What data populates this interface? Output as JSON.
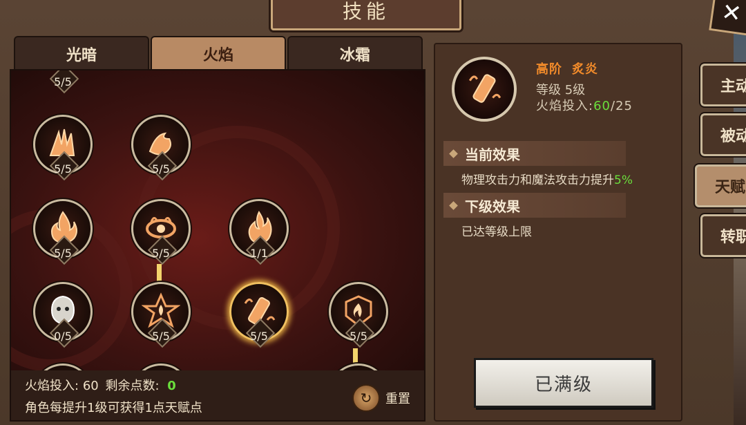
{
  "window": {
    "title": "技能"
  },
  "tabs": [
    {
      "label": "光暗",
      "active": false
    },
    {
      "label": "火焰",
      "active": true
    },
    {
      "label": "冰霜",
      "active": false
    }
  ],
  "tree": {
    "top_partial_level": "5/5",
    "nodes": [
      {
        "name": "fire-claw-skill",
        "level": "5/5"
      },
      {
        "name": "fire-bird-skill",
        "level": "5/5"
      },
      {
        "name": "flame-skill",
        "level": "5/5"
      },
      {
        "name": "fire-eye-skill",
        "level": "5/5"
      },
      {
        "name": "blaze-skill",
        "level": "1/1"
      },
      {
        "name": "shadow-spirit-skill",
        "level": "0/5"
      },
      {
        "name": "fire-pentagram-skill",
        "level": "5/5"
      },
      {
        "name": "burning-skill",
        "level": "5/5",
        "selected": true
      },
      {
        "name": "fire-shield-skill",
        "level": "5/5"
      }
    ]
  },
  "footer": {
    "invest_label": "火焰投入:",
    "invest_value": "60",
    "remaining_label": "剩余点数:",
    "remaining_value": "0",
    "hint": "角色每提升1级可获得1点天赋点",
    "reset_label": "重置"
  },
  "detail": {
    "tier": "高阶",
    "skill_name": "炙炎",
    "level_text": "等级 5级",
    "invest_label": "火焰投入:",
    "invest_current": "60",
    "invest_sep": "/",
    "invest_required": "25",
    "current_effect_title": "当前效果",
    "current_effect_text": "物理攻击力和魔法攻击力提升",
    "current_effect_value": "5%",
    "next_effect_title": "下级效果",
    "next_effect_text": "已达等级上限",
    "max_button": "已满级"
  },
  "side_tabs": [
    {
      "label": "主动"
    },
    {
      "label": "被动"
    },
    {
      "label": "天赋",
      "active": true
    },
    {
      "label": "转职"
    }
  ],
  "colors": {
    "green_value": "#6adf3c",
    "tier_orange": "#f08a2a",
    "selected_glow": "#f0c060"
  }
}
